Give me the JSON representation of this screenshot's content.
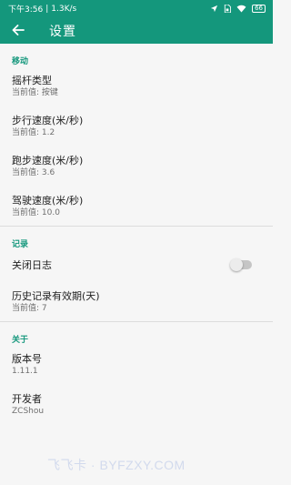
{
  "status_bar": {
    "time": "下午3:56",
    "speed": "1.3K/s",
    "battery": "66"
  },
  "appbar": {
    "title": "设置"
  },
  "sections": [
    {
      "header": "移动",
      "items": [
        {
          "title": "摇杆类型",
          "summary": "当前值: 按键"
        },
        {
          "title": "步行速度(米/秒)",
          "summary": "当前值: 1.2"
        },
        {
          "title": "跑步速度(米/秒)",
          "summary": "当前值: 3.6"
        },
        {
          "title": "驾驶速度(米/秒)",
          "summary": "当前值: 10.0"
        }
      ]
    },
    {
      "header": "记录",
      "items": [
        {
          "title": "关闭日志",
          "switch_on": false
        },
        {
          "title": "历史记录有效期(天)",
          "summary": "当前值: 7"
        }
      ]
    },
    {
      "header": "关于",
      "items": [
        {
          "title": "版本号",
          "summary": "1.11.1"
        },
        {
          "title": "开发者",
          "summary": "ZCShou"
        }
      ]
    }
  ],
  "watermark": "飞飞卡 · BYFZXY.COM",
  "colors": {
    "accent": "#14977c",
    "background": "#f6f6f6"
  }
}
